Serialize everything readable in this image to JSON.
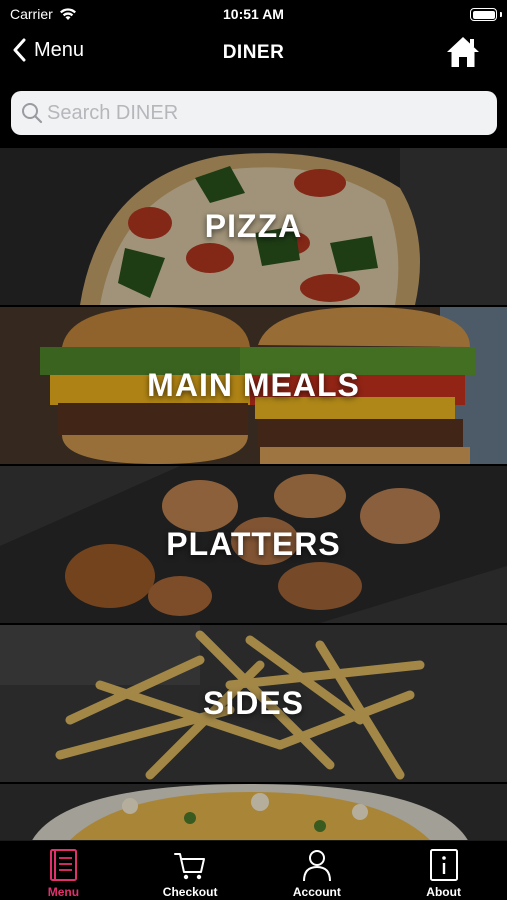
{
  "status_bar": {
    "carrier": "Carrier",
    "time": "10:51 AM",
    "icons": [
      "wifi-icon",
      "battery-icon"
    ]
  },
  "nav": {
    "back_label": "Menu",
    "title": "DINER",
    "icons": [
      "chevron-left-icon",
      "home-icon"
    ]
  },
  "search": {
    "placeholder": "Search DINER",
    "value": ""
  },
  "categories": [
    {
      "label": "PIZZA"
    },
    {
      "label": "MAIN MEALS"
    },
    {
      "label": "PLATTERS"
    },
    {
      "label": "SIDES"
    },
    {
      "label": ""
    }
  ],
  "tab_bar": {
    "active_color": "#e0306e",
    "inactive_color": "#ffffff",
    "tabs": [
      {
        "label": "Menu",
        "icon": "menu-book-icon",
        "active": true
      },
      {
        "label": "Checkout",
        "icon": "cart-icon",
        "active": false
      },
      {
        "label": "Account",
        "icon": "user-icon",
        "active": false
      },
      {
        "label": "About",
        "icon": "info-icon",
        "active": false
      }
    ]
  }
}
